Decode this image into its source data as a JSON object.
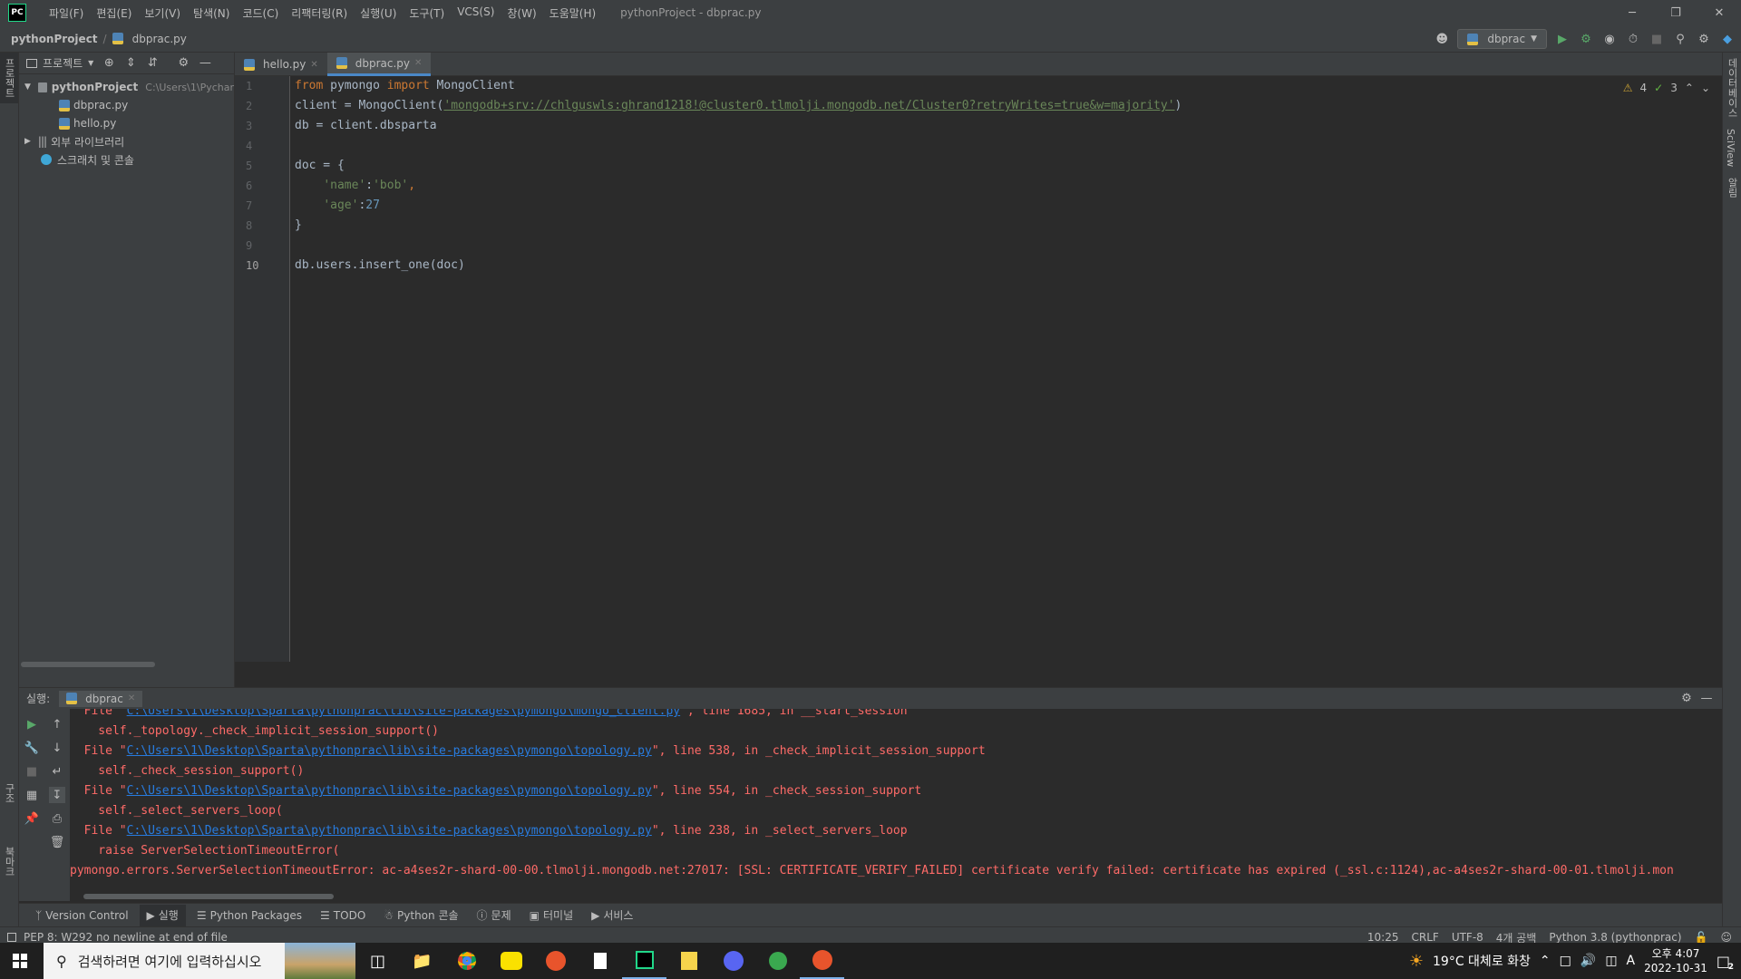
{
  "app": {
    "logo": "PC",
    "window_title": "pythonProject - dbprac.py"
  },
  "menu": [
    "파일(F)",
    "편집(E)",
    "보기(V)",
    "탐색(N)",
    "코드(C)",
    "리팩터링(R)",
    "실행(U)",
    "도구(T)",
    "VCS(S)",
    "창(W)",
    "도움말(H)"
  ],
  "window_controls": {
    "minimize": "─",
    "restore": "❐",
    "close": "✕"
  },
  "breadcrumb": {
    "project": "pythonProject",
    "file": "dbprac.py"
  },
  "run_config": {
    "label": "dbprac"
  },
  "left_stripe": {
    "project": "프로젝트",
    "structure": "구조",
    "bookmarks": "북마크"
  },
  "right_stripe": {
    "database": "데이터베이스",
    "sciview": "SciView",
    "notifications": "알림"
  },
  "project_panel": {
    "title": "프로젝트",
    "tree": [
      {
        "label": "pythonProject",
        "hint": "C:\\Users\\1\\Pychar",
        "type": "folder"
      },
      {
        "label": "dbprac.py",
        "type": "py"
      },
      {
        "label": "hello.py",
        "type": "py"
      },
      {
        "label": "외부 라이브러리",
        "type": "lib"
      },
      {
        "label": "스크래치 및 콘솔",
        "type": "scratch"
      }
    ]
  },
  "tabs": [
    {
      "label": "hello.py",
      "active": false
    },
    {
      "label": "dbprac.py",
      "active": true
    }
  ],
  "editor": {
    "line_numbers": [
      "1",
      "2",
      "3",
      "4",
      "5",
      "6",
      "7",
      "8",
      "9",
      "10"
    ],
    "lines": {
      "l1a": "from",
      "l1b": " pymongo ",
      "l1c": "import",
      "l1d": " MongoClient",
      "l2a": "client = MongoClient(",
      "l2b": "'mongodb+srv://chlguswls:ghrand1218!@cluster0.tlmolji.mongodb.net/Cluster0?retryWrites=true&w=majority'",
      "l2c": ")",
      "l3": "db = client.dbsparta",
      "l5": "doc = {",
      "l6a": "    ",
      "l6b": "'name'",
      "l6c": ":",
      "l6d": "'bob'",
      "l6e": ",",
      "l7a": "    ",
      "l7b": "'age'",
      "l7c": ":",
      "l7d": "27",
      "l8": "}",
      "l10": "db.users.insert_one(doc)"
    },
    "inspections": {
      "warnings": "4",
      "weak_warnings": "3"
    }
  },
  "run_panel": {
    "title": "실행:",
    "tab": "dbprac",
    "console": [
      {
        "pre": "  File \"",
        "link": "C:\\Users\\1\\Desktop\\Sparta\\pythonprac\\lib\\site-packages\\pymongo\\mongo_client.py",
        "post": "\", line 1685, in __start_session"
      },
      {
        "text": "    self._topology._check_implicit_session_support()"
      },
      {
        "pre": "  File \"",
        "link": "C:\\Users\\1\\Desktop\\Sparta\\pythonprac\\lib\\site-packages\\pymongo\\topology.py",
        "post": "\", line 538, in _check_implicit_session_support"
      },
      {
        "text": "    self._check_session_support()"
      },
      {
        "pre": "  File \"",
        "link": "C:\\Users\\1\\Desktop\\Sparta\\pythonprac\\lib\\site-packages\\pymongo\\topology.py",
        "post": "\", line 554, in _check_session_support"
      },
      {
        "text": "    self._select_servers_loop("
      },
      {
        "pre": "  File \"",
        "link": "C:\\Users\\1\\Desktop\\Sparta\\pythonprac\\lib\\site-packages\\pymongo\\topology.py",
        "post": "\", line 238, in _select_servers_loop"
      },
      {
        "text": "    raise ServerSelectionTimeoutError("
      },
      {
        "text": "pymongo.errors.ServerSelectionTimeoutError: ac-a4ses2r-shard-00-00.tlmolji.mongodb.net:27017: [SSL: CERTIFICATE_VERIFY_FAILED] certificate verify failed: certificate has expired (_ssl.c:1124),ac-a4ses2r-shard-00-01.tlmolji.mon"
      }
    ]
  },
  "tool_windows": [
    "Version Control",
    "실행",
    "Python Packages",
    "TODO",
    "Python 콘솔",
    "문제",
    "터미널",
    "서비스"
  ],
  "status": {
    "message": "PEP 8: W292 no newline at end of file",
    "position": "10:25",
    "line_sep": "CRLF",
    "encoding": "UTF-8",
    "indent": "4개 공백",
    "interpreter": "Python 3.8 (pythonprac)"
  },
  "taskbar": {
    "search_placeholder": "검색하려면 여기에 입력하십시오",
    "weather": "19°C 대체로 화창",
    "ime": "A",
    "time": "오후 4:07",
    "date": "2022-10-31",
    "notifications": "2"
  }
}
